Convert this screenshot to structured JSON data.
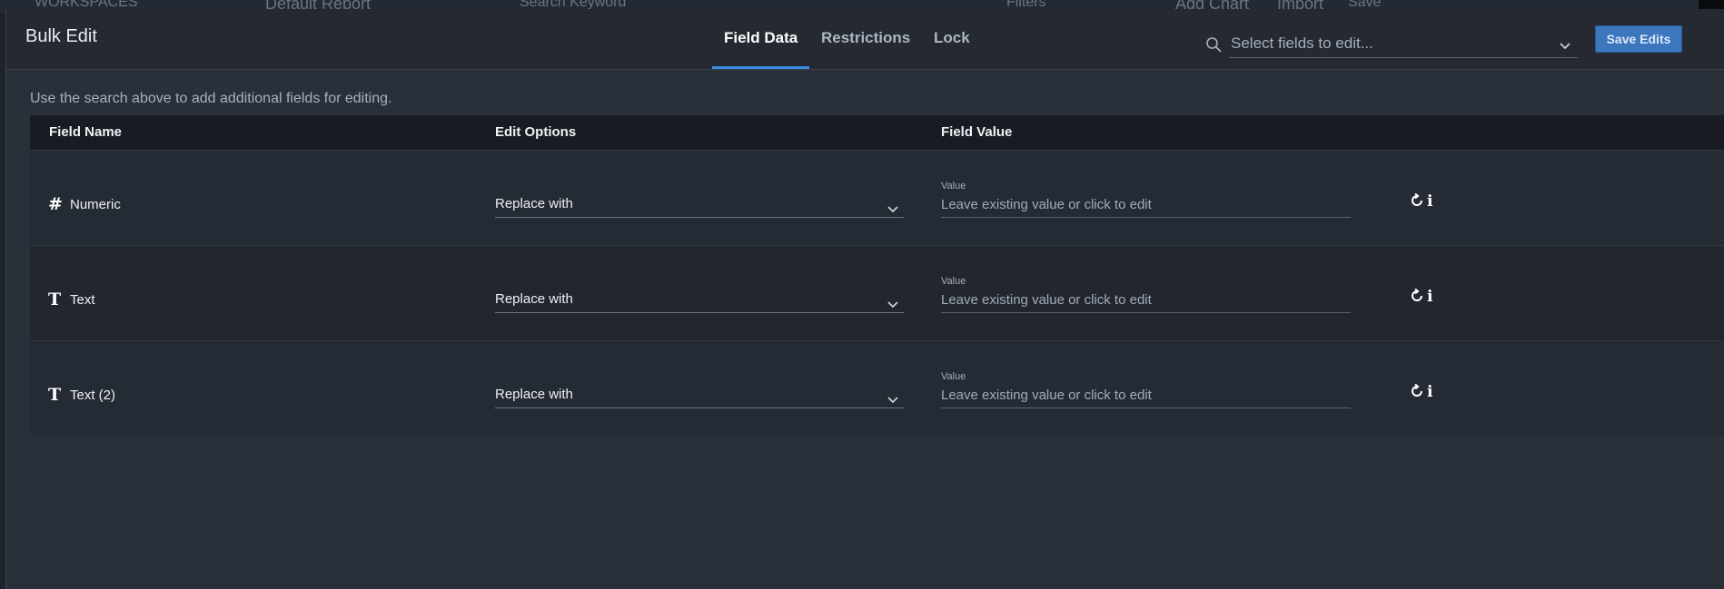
{
  "background": {
    "topbar_text": [
      "WORKSPACES",
      "Default Report",
      "Search Keyword",
      "Filters",
      "Add Chart",
      "Import",
      "Save"
    ]
  },
  "modal": {
    "title": "Bulk Edit",
    "tabs": [
      {
        "label": "Field Data",
        "active": true
      },
      {
        "label": "Restrictions",
        "active": false
      },
      {
        "label": "Lock",
        "active": false
      }
    ],
    "search": {
      "placeholder": "Select fields to edit..."
    },
    "save_label": "Save Edits",
    "hint": "Use the search above to add additional fields for editing.",
    "table": {
      "headers": [
        "Field Name",
        "Edit Options",
        "Field Value"
      ],
      "rows": [
        {
          "icon": "hash-icon",
          "name": "Numeric",
          "option": "Replace with",
          "value_label": "Value",
          "value_placeholder": "Leave existing value or click to edit"
        },
        {
          "icon": "text-type-icon",
          "name": "Text",
          "option": "Replace with",
          "value_label": "Value",
          "value_placeholder": "Leave existing value or click to edit"
        },
        {
          "icon": "text-type-icon",
          "name": "Text (2)",
          "option": "Replace with",
          "value_label": "Value",
          "value_placeholder": "Leave existing value or click to edit"
        }
      ]
    }
  },
  "colors": {
    "accent": "#3d8de0",
    "save_button": "#3c76bd",
    "header_bg": "#242932",
    "body_bg": "#2a3039"
  }
}
